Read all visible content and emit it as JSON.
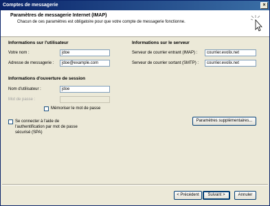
{
  "window": {
    "title": "Comptes de messagerie"
  },
  "header": {
    "title": "Paramètres de messagerie Internet (IMAP)",
    "subtitle": "Chacun de ces paramètres est obligatoire pour que votre compte de messagerie fonctionne.",
    "icon": "cursor-click-icon"
  },
  "user_info": {
    "heading": "Informations sur l'utilisateur",
    "name_label": "Votre nom :",
    "name_value": "jdoe",
    "email_label": "Adresse de messagerie :",
    "email_value": "jdoe@example.com"
  },
  "server_info": {
    "heading": "Informations sur le serveur",
    "incoming_label": "Serveur de courrier entrant (IMAP) :",
    "incoming_value": "courrier.evolix.net",
    "outgoing_label": "Serveur de courrier sortant (SMTP) :",
    "outgoing_value": "courrier.evolix.net"
  },
  "login_info": {
    "heading": "Informations d'ouverture de session",
    "username_label": "Nom d'utilisateur :",
    "username_value": "jdoe",
    "password_label": "Mot de passe :",
    "password_value": "",
    "remember_label": "Mémoriser le mot de passe",
    "remember_checked": false
  },
  "spa": {
    "label_line1": "Se connecter à l'aide de",
    "label_line2": "l'authentification par mot de passe",
    "label_line3": "sécurisé (SPA)",
    "checked": false
  },
  "buttons": {
    "more_settings": "Paramètres supplémentaires...",
    "previous": "< Précédent",
    "next": "Suivant >",
    "cancel": "Annuler",
    "close_glyph": "×"
  }
}
